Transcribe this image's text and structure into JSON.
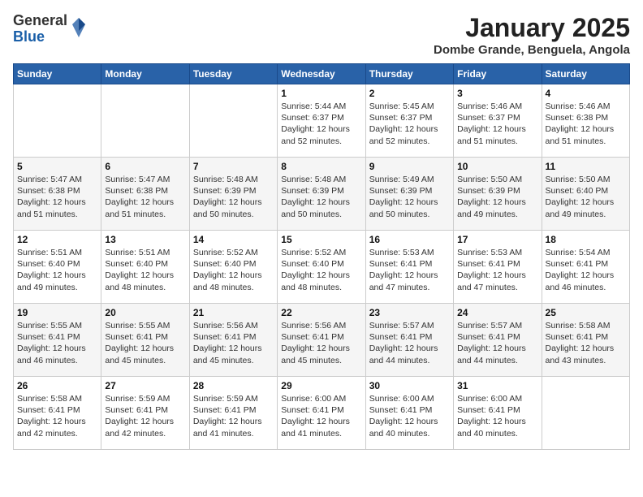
{
  "logo": {
    "general": "General",
    "blue": "Blue"
  },
  "title": "January 2025",
  "subtitle": "Dombe Grande, Benguela, Angola",
  "days_of_week": [
    "Sunday",
    "Monday",
    "Tuesday",
    "Wednesday",
    "Thursday",
    "Friday",
    "Saturday"
  ],
  "weeks": [
    [
      {
        "day": "",
        "info": ""
      },
      {
        "day": "",
        "info": ""
      },
      {
        "day": "",
        "info": ""
      },
      {
        "day": "1",
        "info": "Sunrise: 5:44 AM\nSunset: 6:37 PM\nDaylight: 12 hours\nand 52 minutes."
      },
      {
        "day": "2",
        "info": "Sunrise: 5:45 AM\nSunset: 6:37 PM\nDaylight: 12 hours\nand 52 minutes."
      },
      {
        "day": "3",
        "info": "Sunrise: 5:46 AM\nSunset: 6:37 PM\nDaylight: 12 hours\nand 51 minutes."
      },
      {
        "day": "4",
        "info": "Sunrise: 5:46 AM\nSunset: 6:38 PM\nDaylight: 12 hours\nand 51 minutes."
      }
    ],
    [
      {
        "day": "5",
        "info": "Sunrise: 5:47 AM\nSunset: 6:38 PM\nDaylight: 12 hours\nand 51 minutes."
      },
      {
        "day": "6",
        "info": "Sunrise: 5:47 AM\nSunset: 6:38 PM\nDaylight: 12 hours\nand 51 minutes."
      },
      {
        "day": "7",
        "info": "Sunrise: 5:48 AM\nSunset: 6:39 PM\nDaylight: 12 hours\nand 50 minutes."
      },
      {
        "day": "8",
        "info": "Sunrise: 5:48 AM\nSunset: 6:39 PM\nDaylight: 12 hours\nand 50 minutes."
      },
      {
        "day": "9",
        "info": "Sunrise: 5:49 AM\nSunset: 6:39 PM\nDaylight: 12 hours\nand 50 minutes."
      },
      {
        "day": "10",
        "info": "Sunrise: 5:50 AM\nSunset: 6:39 PM\nDaylight: 12 hours\nand 49 minutes."
      },
      {
        "day": "11",
        "info": "Sunrise: 5:50 AM\nSunset: 6:40 PM\nDaylight: 12 hours\nand 49 minutes."
      }
    ],
    [
      {
        "day": "12",
        "info": "Sunrise: 5:51 AM\nSunset: 6:40 PM\nDaylight: 12 hours\nand 49 minutes."
      },
      {
        "day": "13",
        "info": "Sunrise: 5:51 AM\nSunset: 6:40 PM\nDaylight: 12 hours\nand 48 minutes."
      },
      {
        "day": "14",
        "info": "Sunrise: 5:52 AM\nSunset: 6:40 PM\nDaylight: 12 hours\nand 48 minutes."
      },
      {
        "day": "15",
        "info": "Sunrise: 5:52 AM\nSunset: 6:40 PM\nDaylight: 12 hours\nand 48 minutes."
      },
      {
        "day": "16",
        "info": "Sunrise: 5:53 AM\nSunset: 6:41 PM\nDaylight: 12 hours\nand 47 minutes."
      },
      {
        "day": "17",
        "info": "Sunrise: 5:53 AM\nSunset: 6:41 PM\nDaylight: 12 hours\nand 47 minutes."
      },
      {
        "day": "18",
        "info": "Sunrise: 5:54 AM\nSunset: 6:41 PM\nDaylight: 12 hours\nand 46 minutes."
      }
    ],
    [
      {
        "day": "19",
        "info": "Sunrise: 5:55 AM\nSunset: 6:41 PM\nDaylight: 12 hours\nand 46 minutes."
      },
      {
        "day": "20",
        "info": "Sunrise: 5:55 AM\nSunset: 6:41 PM\nDaylight: 12 hours\nand 45 minutes."
      },
      {
        "day": "21",
        "info": "Sunrise: 5:56 AM\nSunset: 6:41 PM\nDaylight: 12 hours\nand 45 minutes."
      },
      {
        "day": "22",
        "info": "Sunrise: 5:56 AM\nSunset: 6:41 PM\nDaylight: 12 hours\nand 45 minutes."
      },
      {
        "day": "23",
        "info": "Sunrise: 5:57 AM\nSunset: 6:41 PM\nDaylight: 12 hours\nand 44 minutes."
      },
      {
        "day": "24",
        "info": "Sunrise: 5:57 AM\nSunset: 6:41 PM\nDaylight: 12 hours\nand 44 minutes."
      },
      {
        "day": "25",
        "info": "Sunrise: 5:58 AM\nSunset: 6:41 PM\nDaylight: 12 hours\nand 43 minutes."
      }
    ],
    [
      {
        "day": "26",
        "info": "Sunrise: 5:58 AM\nSunset: 6:41 PM\nDaylight: 12 hours\nand 42 minutes."
      },
      {
        "day": "27",
        "info": "Sunrise: 5:59 AM\nSunset: 6:41 PM\nDaylight: 12 hours\nand 42 minutes."
      },
      {
        "day": "28",
        "info": "Sunrise: 5:59 AM\nSunset: 6:41 PM\nDaylight: 12 hours\nand 41 minutes."
      },
      {
        "day": "29",
        "info": "Sunrise: 6:00 AM\nSunset: 6:41 PM\nDaylight: 12 hours\nand 41 minutes."
      },
      {
        "day": "30",
        "info": "Sunrise: 6:00 AM\nSunset: 6:41 PM\nDaylight: 12 hours\nand 40 minutes."
      },
      {
        "day": "31",
        "info": "Sunrise: 6:00 AM\nSunset: 6:41 PM\nDaylight: 12 hours\nand 40 minutes."
      },
      {
        "day": "",
        "info": ""
      }
    ]
  ]
}
